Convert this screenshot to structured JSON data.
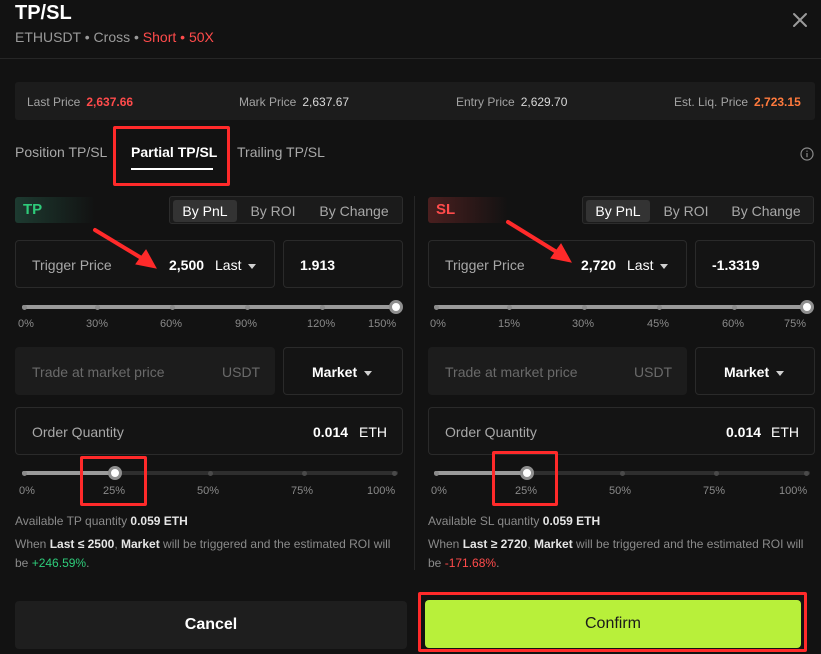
{
  "header": {
    "title": "TP/SL",
    "symbol": "ETHUSDT",
    "sep1": " • ",
    "margin_mode": "Cross",
    "sep2": " • ",
    "side": "Short",
    "sep3": " • ",
    "leverage": "50X"
  },
  "price_bar": {
    "last_label": "Last Price",
    "last_value": "2,637.66",
    "mark_label": "Mark Price",
    "mark_value": "2,637.67",
    "entry_label": "Entry Price",
    "entry_value": "2,629.70",
    "liq_label": "Est. Liq. Price",
    "liq_value": "2,723.15"
  },
  "tabs": {
    "position": "Position TP/SL",
    "partial": "Partial TP/SL",
    "trailing": "Trailing TP/SL",
    "active": "Partial TP/SL"
  },
  "tp": {
    "badge": "TP",
    "modes": [
      "By PnL",
      "By ROI",
      "By Change"
    ],
    "active_mode": "By PnL",
    "trigger_label": "Trigger Price",
    "trigger_value": "2,500",
    "trigger_type": "Last",
    "pnl_value": "1.913",
    "trigger_slider_ticks": [
      "0%",
      "30%",
      "60%",
      "90%",
      "120%",
      "150%"
    ],
    "trigger_slider_level": 1.0,
    "trade_placeholder": "Trade at market price",
    "trade_unit": "USDT",
    "order_type": "Market",
    "qty_label": "Order Quantity",
    "qty_value": "0.014",
    "qty_unit": "ETH",
    "qty_slider_ticks": [
      "0%",
      "25%",
      "50%",
      "75%",
      "100%"
    ],
    "qty_slider_level": 0.25,
    "available_label": "Available TP quantity",
    "available_value": "0.059 ETH",
    "note_when": "When",
    "note_cond": "Last ≤ 2500",
    "note_order": "Market",
    "note_mid": "will be triggered and the estimated ROI will",
    "note_be": "be",
    "note_roi": "+246.59%",
    "note_end": "."
  },
  "sl": {
    "badge": "SL",
    "modes": [
      "By PnL",
      "By ROI",
      "By Change"
    ],
    "active_mode": "By PnL",
    "trigger_label": "Trigger Price",
    "trigger_value": "2,720",
    "trigger_type": "Last",
    "pnl_value": "-1.3319",
    "trigger_slider_ticks": [
      "0%",
      "15%",
      "30%",
      "45%",
      "60%",
      "75%"
    ],
    "trigger_slider_level": 1.0,
    "trade_placeholder": "Trade at market price",
    "trade_unit": "USDT",
    "order_type": "Market",
    "qty_label": "Order Quantity",
    "qty_value": "0.014",
    "qty_unit": "ETH",
    "qty_slider_ticks": [
      "0%",
      "25%",
      "50%",
      "75%",
      "100%"
    ],
    "qty_slider_level": 0.25,
    "available_label": "Available SL quantity",
    "available_value": "0.059 ETH",
    "note_when": "When",
    "note_cond": "Last ≥ 2720",
    "note_order": "Market",
    "note_mid": "will be triggered and the estimated ROI will",
    "note_be": "be",
    "note_roi": "-171.68%",
    "note_end": "."
  },
  "footer": {
    "cancel": "Cancel",
    "confirm": "Confirm"
  },
  "colors": {
    "accent_green": "#b8f03a",
    "profit": "#2ecc7a",
    "loss": "#ff4b4b",
    "highlight_box": "#ff2a2a"
  },
  "icons": {
    "close": "close-icon",
    "info": "info-icon",
    "dropdown": "caret-down-icon",
    "annotation": "arrow-annotation-icon"
  }
}
